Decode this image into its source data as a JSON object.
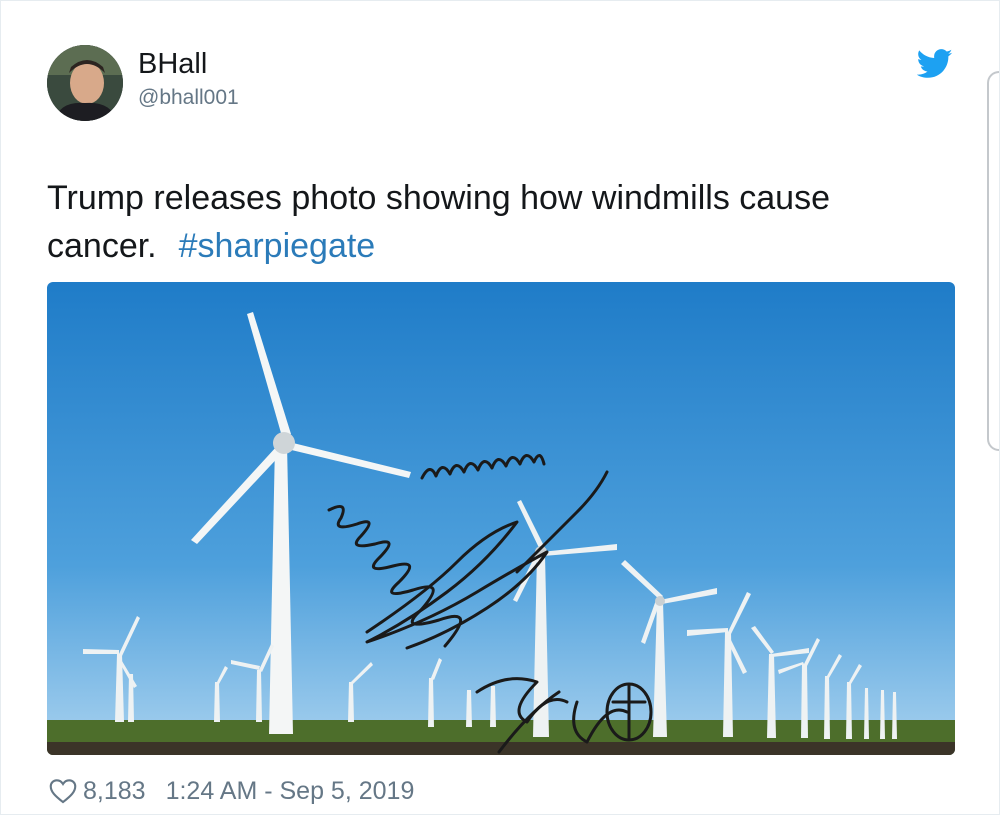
{
  "user": {
    "display_name": "BHall",
    "handle": "@bhall001",
    "avatar_icon": "avatar-photo"
  },
  "platform_icon": "twitter-bird-icon",
  "tweet": {
    "text": "Trump releases photo showing how windmills cause cancer.",
    "hashtag": "#sharpiegate"
  },
  "media": {
    "description_icon": "wind-turbines-photo",
    "sky_color": "#2f87d1",
    "ground_color": "#4a6b2a"
  },
  "footer": {
    "likes": "8,183",
    "timestamp": "1:24 AM - Sep 5, 2019"
  },
  "colors": {
    "accent": "#2b7bb9",
    "bird": "#1da1f2",
    "text": "#14171a",
    "muted": "#657786"
  }
}
